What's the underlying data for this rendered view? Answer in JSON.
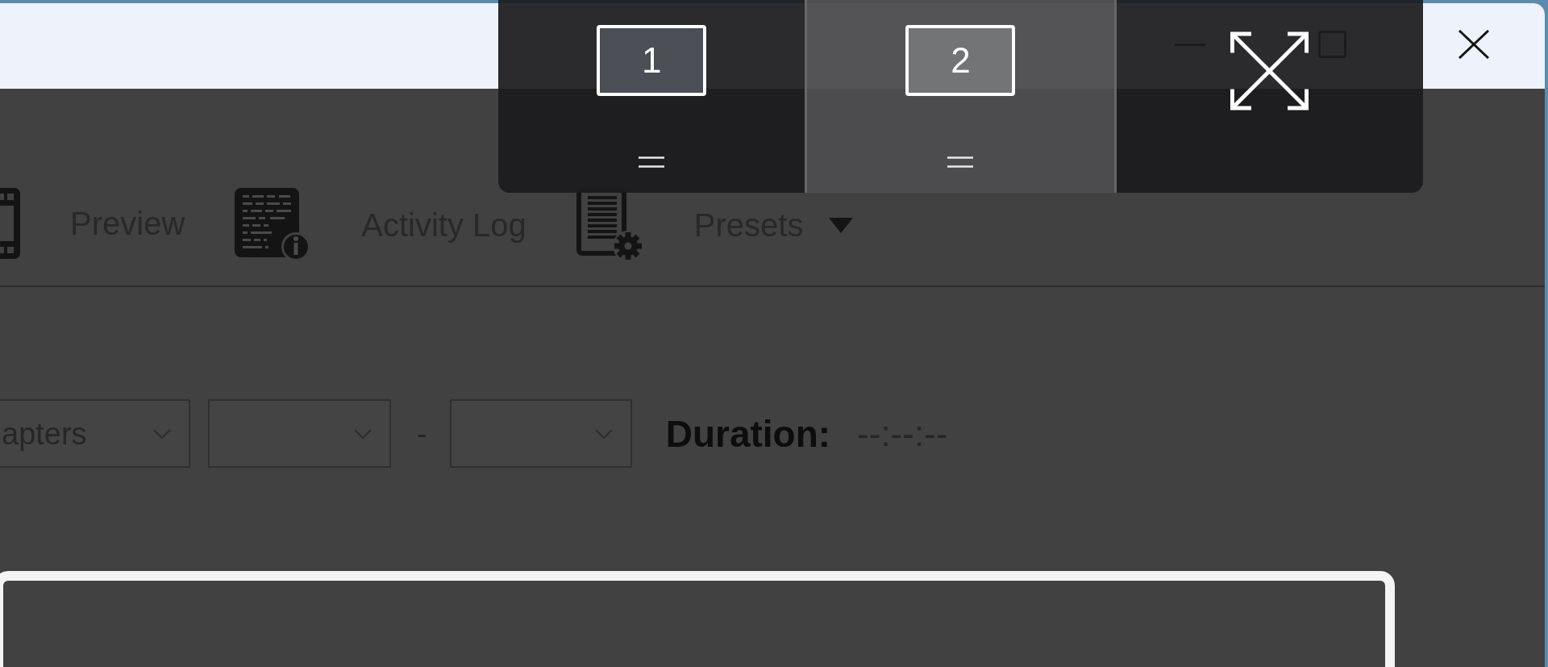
{
  "window": {
    "toolbar": [
      {
        "kind": "preview",
        "label": "Preview",
        "dropdown": false
      },
      {
        "kind": "activity_log",
        "label": "Activity Log",
        "dropdown": false
      },
      {
        "kind": "presets",
        "label": "Presets",
        "dropdown": true
      }
    ],
    "range": {
      "source": "apters",
      "separator": "-",
      "duration_label": "Duration:",
      "duration_value": "--:--:--"
    }
  },
  "snap_flyout": {
    "targets": [
      {
        "kind": "display",
        "label": "1",
        "selected": false
      },
      {
        "kind": "display",
        "label": "2",
        "selected": true
      },
      {
        "kind": "maximize",
        "selected": false
      }
    ]
  }
}
